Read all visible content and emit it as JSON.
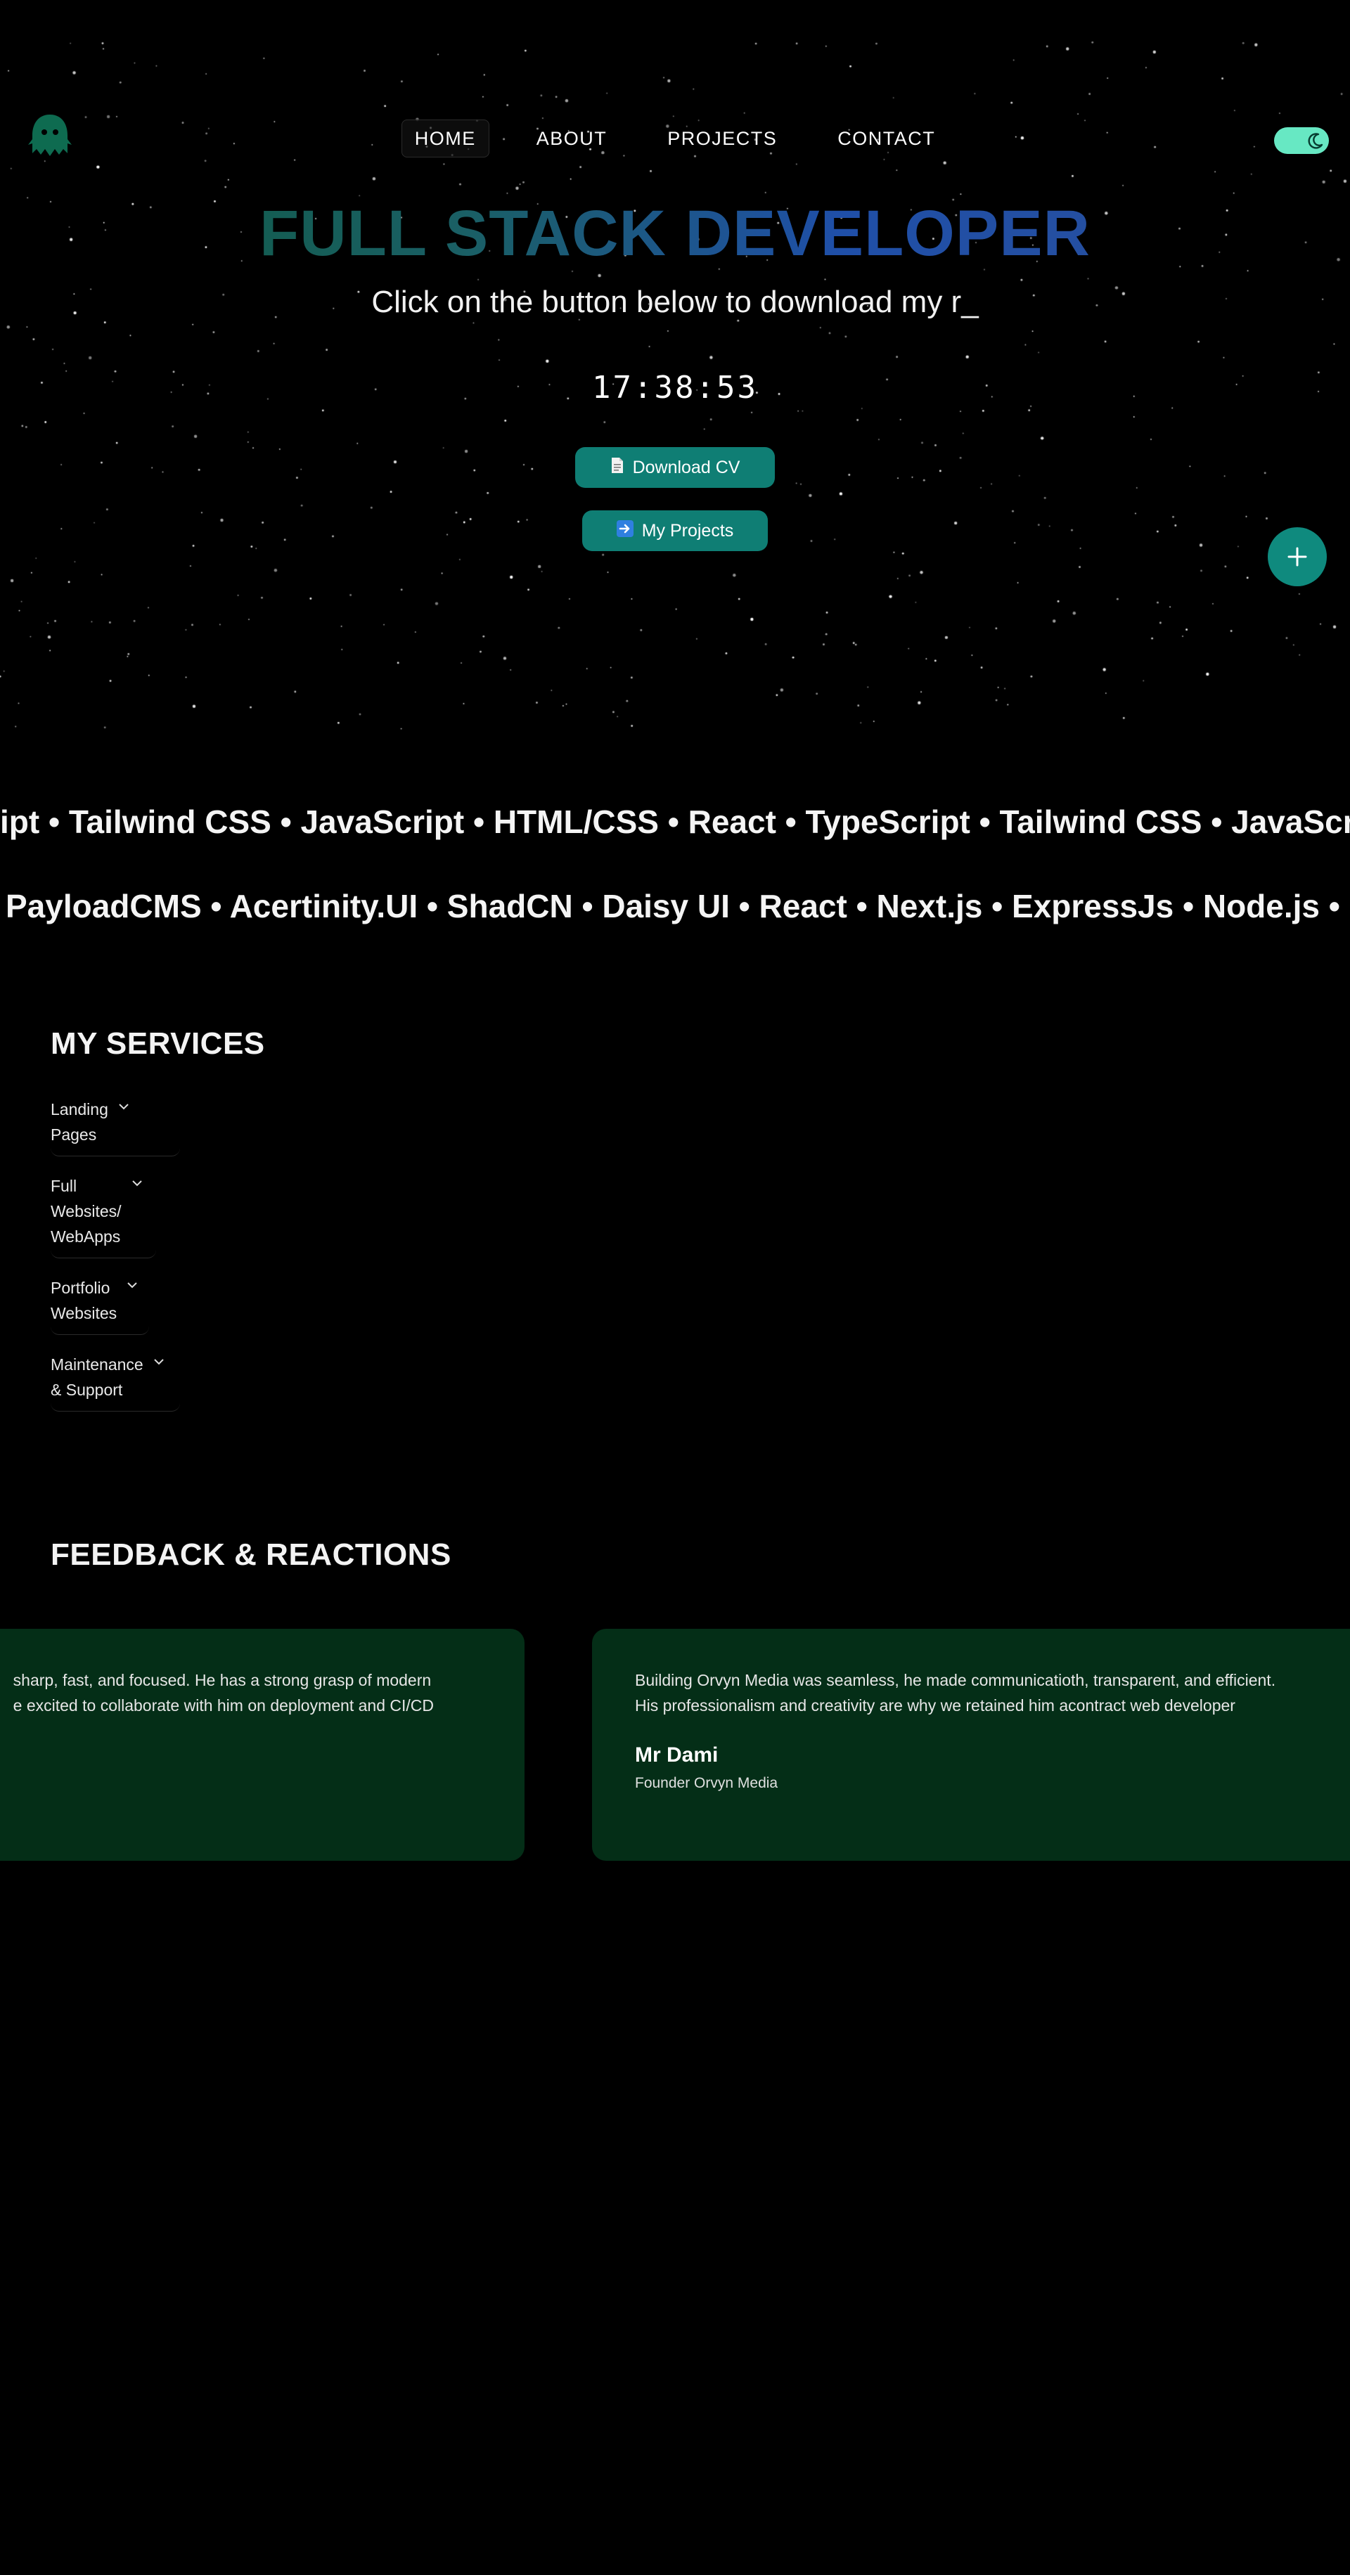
{
  "nav": {
    "items": [
      {
        "label": "HOME",
        "active": true
      },
      {
        "label": "ABOUT",
        "active": false
      },
      {
        "label": "PROJECTS",
        "active": false
      },
      {
        "label": "CONTACT",
        "active": false
      }
    ]
  },
  "logo_icon": "ghost-icon",
  "theme_toggle_icon": "moon-icon",
  "hero": {
    "title": "FULL STACK DEVELOPER",
    "subtitle": "Click on the button below to download my r_",
    "clock": "17:38:53",
    "download_cv_label": "Download CV",
    "download_cv_icon": "document-icon",
    "my_projects_label": "My Projects",
    "my_projects_icon": "arrow-right-icon"
  },
  "fab_icon": "plus-icon",
  "marquee": {
    "row1": "ipt • Tailwind CSS • JavaScript • HTML/CSS •  React • TypeScript • Tailwind CSS • JavaScript • HTML/CSS",
    "row2": "PayloadCMS •  Acertinity.UI • ShadCN • Daisy UI • React • Next.js • ExpressJs • Node.js • React"
  },
  "services": {
    "title": "MY SERVICES",
    "items": [
      {
        "lines": [
          "Landing",
          "Pages"
        ]
      },
      {
        "lines": [
          "Full",
          "Websites/",
          "WebApps"
        ]
      },
      {
        "lines": [
          "Portfolio",
          "Websites"
        ]
      },
      {
        "lines": [
          "Maintenance",
          "& Support"
        ]
      }
    ]
  },
  "feedback": {
    "title": "FEEDBACK & REACTIONS",
    "cards": [
      {
        "lines": [
          "sharp, fast, and focused. He has a strong grasp of modern",
          "e excited to collaborate with him on deployment and CI/CD"
        ],
        "author": "",
        "role": ""
      },
      {
        "lines": [
          "Building Orvyn Media was seamless, he made communicatioth, transparent, and efficient.",
          "His professionalism and creativity are why we retained him acontract web developer"
        ],
        "author": "Mr Dami",
        "role": "Founder Orvyn Media"
      }
    ]
  },
  "colors": {
    "background": "#000000",
    "accent": "#0f7e74",
    "toggle": "#67e8c3",
    "card": "#042e17",
    "title_gradient_start": "#0d5a3c",
    "title_gradient_end": "#2a4f9a"
  }
}
